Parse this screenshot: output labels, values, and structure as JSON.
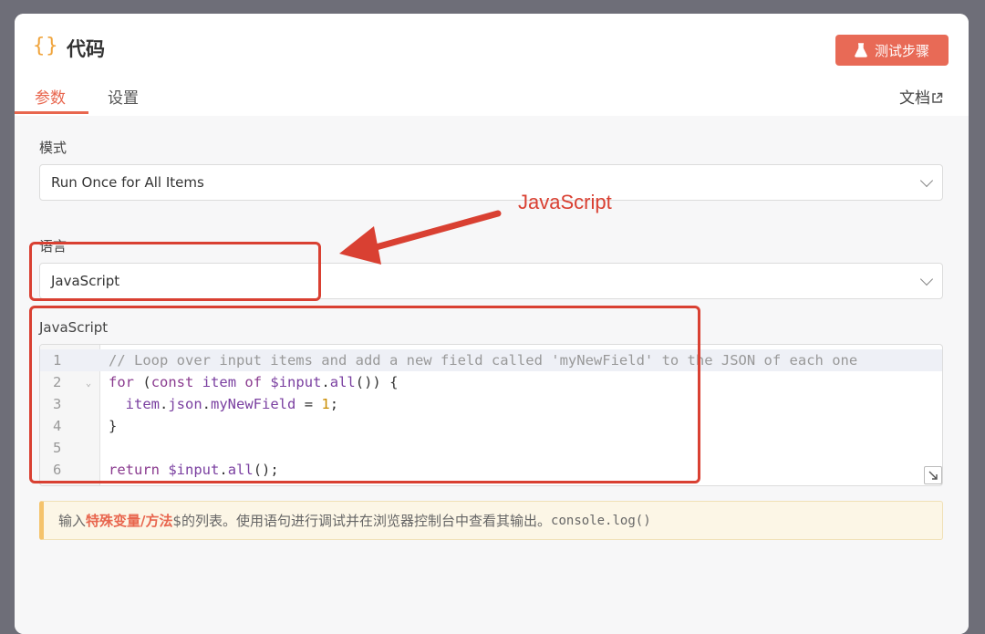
{
  "header": {
    "icon": "curly-braces-icon",
    "icon_glyph": "{}",
    "title": "代码",
    "test_button_label": "测试步骤",
    "test_button_icon": "flask-icon"
  },
  "tabs": [
    {
      "label": "参数",
      "active": true
    },
    {
      "label": "设置",
      "active": false
    }
  ],
  "docs_link": {
    "label": "文档",
    "icon": "external-link-icon"
  },
  "fields": {
    "mode": {
      "label": "模式",
      "value": "Run Once for All Items"
    },
    "language": {
      "label": "语言",
      "value": "JavaScript"
    },
    "code_label": "JavaScript"
  },
  "code_lines": [
    {
      "num": "1",
      "text": "// Loop over input items and add a new field called 'myNewField' to the JSON of each one"
    },
    {
      "num": "2",
      "text": "for (const item of $input.all()) {"
    },
    {
      "num": "3",
      "text": "  item.json.myNewField = 1;"
    },
    {
      "num": "4",
      "text": "}"
    },
    {
      "num": "5",
      "text": ""
    },
    {
      "num": "6",
      "text": "return $input.all();"
    }
  ],
  "hint": {
    "prefix": "输入",
    "highlight": "特殊变量/方法",
    "suffix": "$的列表。使用语句进行调试并在浏览器控制台中查看其输出。",
    "code": "console.log()"
  },
  "annotation": {
    "text": "JavaScript",
    "color": "#d94032"
  },
  "colors": {
    "accent": "#e8664e",
    "button": "#e86a56",
    "annotation": "#d94032"
  }
}
